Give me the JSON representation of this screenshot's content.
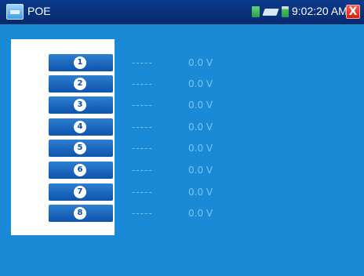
{
  "title_bar": {
    "app_title": "POE",
    "clock": "9:02:20 AM",
    "icons": [
      "sd-card-icon",
      "network-icon",
      "battery-icon",
      "close-icon"
    ],
    "close_label": "X"
  },
  "ports": [
    {
      "pin": "1",
      "status": "-----",
      "voltage": "0.0 V"
    },
    {
      "pin": "2",
      "status": "-----",
      "voltage": "0.0 V"
    },
    {
      "pin": "3",
      "status": "-----",
      "voltage": "0.0 V"
    },
    {
      "pin": "4",
      "status": "-----",
      "voltage": "0.0 V"
    },
    {
      "pin": "5",
      "status": "-----",
      "voltage": "0.0 V"
    },
    {
      "pin": "6",
      "status": "-----",
      "voltage": "0.0 V"
    },
    {
      "pin": "7",
      "status": "-----",
      "voltage": "0.0 V"
    },
    {
      "pin": "8",
      "status": "-----",
      "voltage": "0.0 V"
    }
  ],
  "colors": {
    "background": "#1a8ad6",
    "title_bar": "#0b3a8c",
    "pin_button": "#0d54ad",
    "reading_text": "#7cc4ee"
  }
}
